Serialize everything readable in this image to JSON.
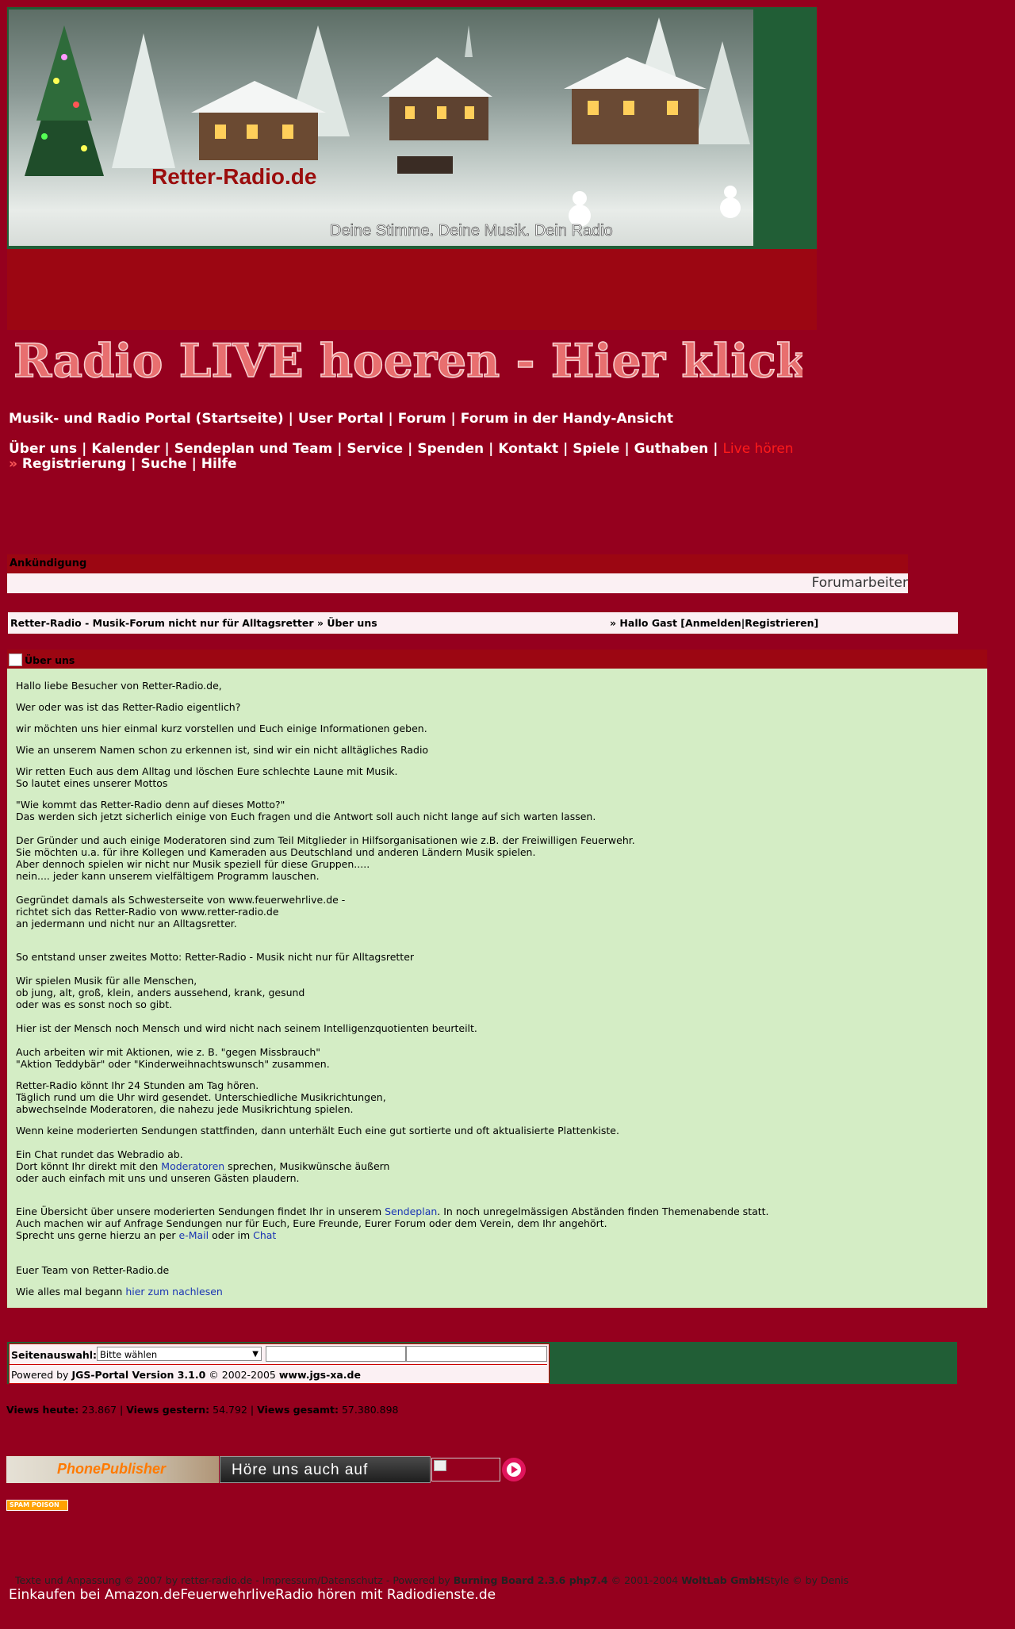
{
  "banner": {
    "site_name": "Retter-Radio.de",
    "slogan": "Deine Stimme. Deine Musik. Dein Radio"
  },
  "live_banner": {
    "text": "Radio LIVE hoeren - Hier klicken"
  },
  "nav1": [
    "Musik- und Radio Portal (Startseite)",
    "User Portal",
    "Forum",
    "Forum in der Handy-Ansicht"
  ],
  "nav2": [
    "Über uns",
    "Kalender",
    "Sendeplan und Team",
    "Service",
    "Spenden",
    "Kontakt",
    "Spiele",
    "Guthaben"
  ],
  "nav2_live": "Live hören",
  "nav3_prefix": "»",
  "nav3": [
    "Registrierung",
    "Suche",
    "Hilfe"
  ],
  "announcement": {
    "title": "Ankündigung",
    "ticker": "Forumarbeiter"
  },
  "breadcrumb": {
    "path": "Retter-Radio - Musik-Forum nicht nur für Alltagsretter » Über uns",
    "greeting": "» Hallo Gast [",
    "login": "Anmelden",
    "sep": "|",
    "register": "Registrieren",
    "close": "]"
  },
  "content": {
    "title": "Über uns",
    "lines": {
      "l1": "Hallo liebe Besucher von Retter-Radio.de,",
      "l2": "Wer oder was ist das Retter-Radio eigentlich?",
      "l3": "wir möchten uns hier einmal kurz vorstellen und Euch einige Informationen geben.",
      "l4": "Wie an unserem Namen schon zu erkennen ist, sind wir ein nicht alltägliches Radio",
      "l5": "Wir retten Euch aus dem Alltag und löschen Eure schlechte Laune mit Musik.",
      "l6": "So lautet eines unserer Mottos",
      "l7": "\"Wie kommt das Retter-Radio denn auf dieses Motto?\"",
      "l8": "Das werden sich jetzt sicherlich einige von Euch fragen und die Antwort soll auch nicht lange auf sich warten lassen.",
      "l9": "Der Gründer und auch einige Moderatoren sind zum Teil Mitglieder in Hilfsorganisationen wie z.B. der Freiwilligen Feuerwehr.",
      "l10": "Sie möchten u.a. für ihre Kollegen und Kameraden aus Deutschland und anderen Ländern Musik spielen.",
      "l11": "Aber dennoch spielen wir nicht nur Musik speziell für diese Gruppen.....",
      "l12": "nein.... jeder kann unserem vielfältigem Programm lauschen.",
      "l13": "Gegründet damals als Schwesterseite von www.feuerwehrlive.de -",
      "l14": "richtet sich das Retter-Radio von www.retter-radio.de",
      "l15": "an jedermann und nicht nur an Alltagsretter.",
      "l16": "So entstand unser zweites Motto: Retter-Radio - Musik nicht nur für Alltagsretter",
      "l17": "Wir spielen Musik für alle Menschen,",
      "l18": "ob jung, alt, groß, klein, anders aussehend, krank, gesund",
      "l19": "oder was es sonst noch so gibt.",
      "l20": "Hier ist der Mensch noch Mensch und wird nicht nach seinem Intelligenzquotienten beurteilt.",
      "l21": "Auch arbeiten wir mit Aktionen, wie z. B. \"gegen Missbrauch\"",
      "l22": "\"Aktion Teddybär\" oder \"Kinderweihnachtswunsch\" zusammen.",
      "l23": "Retter-Radio könnt Ihr 24 Stunden am Tag hören.",
      "l24": "Täglich rund um die Uhr wird gesendet. Unterschiedliche Musikrichtungen,",
      "l25": "abwechselnde Moderatoren, die nahezu jede Musikrichtung spielen.",
      "l26": "Wenn keine moderierten Sendungen stattfinden, dann unterhält Euch eine gut sortierte und oft aktualisierte Plattenkiste.",
      "l27": "Ein Chat rundet das Webradio ab.",
      "l28a": "Dort könnt Ihr direkt mit den ",
      "l28link": "Moderatoren",
      "l28b": " sprechen, Musikwünsche äußern",
      "l29": "oder auch einfach mit uns und unseren Gästen plaudern.",
      "l30a": "Eine Übersicht über unsere moderierten Sendungen findet Ihr in unserem ",
      "l30link": "Sendeplan",
      "l30b": ". In noch unregelmässigen Abständen finden Themenabende statt.",
      "l31": "Auch machen wir auf Anfrage Sendungen nur für Euch, Eure Freunde, Eurer Forum oder dem Verein, dem Ihr angehört.",
      "l32a": "Sprecht uns gerne hierzu an per ",
      "l32link1": "e-Mail",
      "l32b": " oder im ",
      "l32link2": "Chat",
      "l33": "Euer Team von Retter-Radio.de",
      "l34a": "Wie alles mal begann ",
      "l34link": "hier zum nachlesen"
    }
  },
  "footer": {
    "select_label": "Seitenauswahl:",
    "select_value": "Bitte wählen",
    "powered_prefix": "Powered by ",
    "powered_name": "JGS-Portal Version 3.1.0",
    "powered_copy": " © 2002-2005 ",
    "powered_site": "www.jgs-xa.de"
  },
  "views": {
    "today_label": "Views heute:",
    "today": "23.867",
    "sep": "|",
    "yesterday_label": "Views gestern:",
    "yesterday": "54.792",
    "total_label": "Views gesamt:",
    "total": "57.380.898"
  },
  "badges": {
    "phonepublisher": "PhonePublisher",
    "hoere": "Höre uns auch auf",
    "spam": "SPAM POISON"
  },
  "bottom": {
    "t1": "Texte und Anpassung © 2007 by retter-radio.de - Impressum/Datenschutz - Powered by ",
    "t2": "Burning Board 2.3.6 php7.4",
    "t3": " © 2001-2004 ",
    "t4": "WoltLab GmbH",
    "t5": "Style © by Denis",
    "links": "Einkaufen bei Amazon.deFeuerwehrliveRadio hören mit Radiodienste.de"
  },
  "colors": {
    "page_bg": "#95001e",
    "header_red": "#9c0612",
    "content_green": "#d4edc5",
    "banner_green": "#215e36",
    "live_red": "#ff1a1a"
  }
}
